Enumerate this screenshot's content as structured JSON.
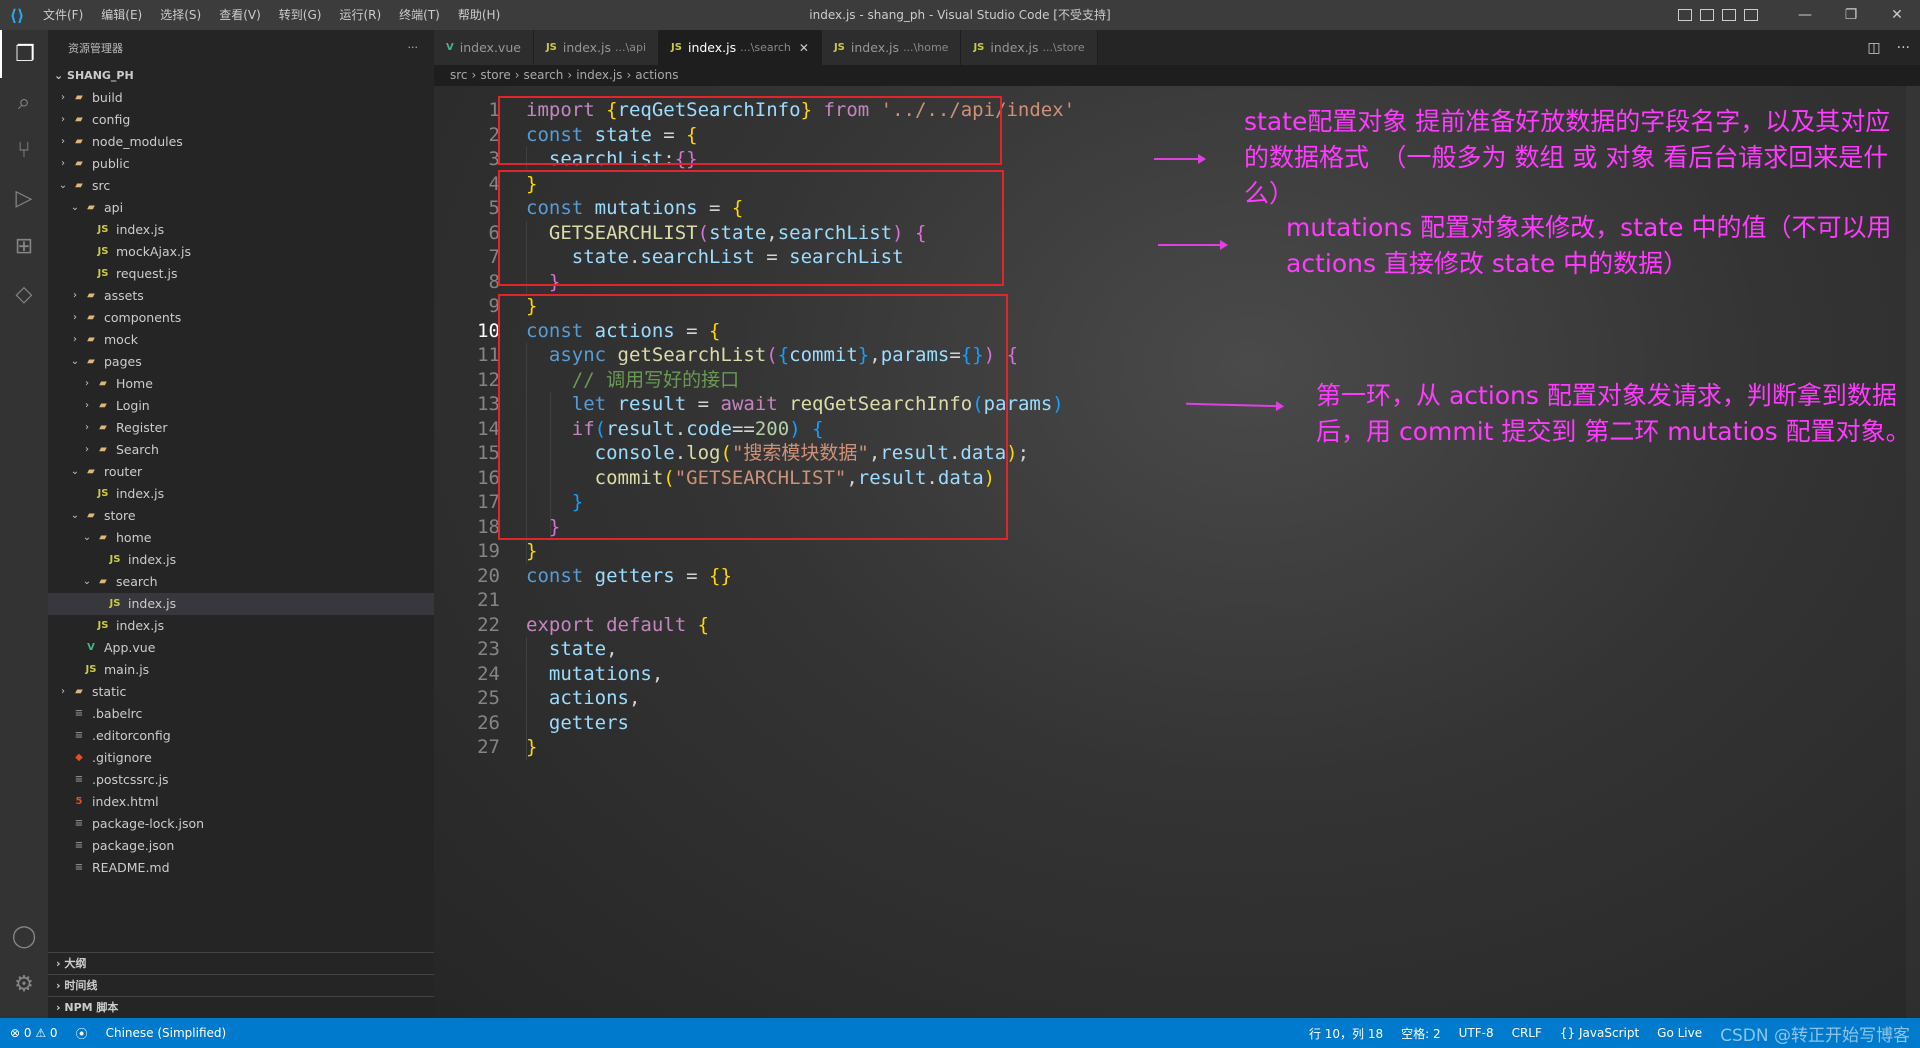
{
  "titlebar": {
    "menu": [
      "文件(F)",
      "编辑(E)",
      "选择(S)",
      "查看(V)",
      "转到(G)",
      "运行(R)",
      "终端(T)",
      "帮助(H)"
    ],
    "title": "index.js - shang_ph - Visual Studio Code [不受支持]"
  },
  "sidebar": {
    "header": "资源管理器",
    "more": "···",
    "root": "SHANG_PH",
    "tree": [
      {
        "label": "build",
        "depth": 1,
        "kind": "folder",
        "open": false
      },
      {
        "label": "config",
        "depth": 1,
        "kind": "folder",
        "open": false
      },
      {
        "label": "node_modules",
        "depth": 1,
        "kind": "folder",
        "open": false
      },
      {
        "label": "public",
        "depth": 1,
        "kind": "folder",
        "open": false
      },
      {
        "label": "src",
        "depth": 1,
        "kind": "folder",
        "open": true
      },
      {
        "label": "api",
        "depth": 2,
        "kind": "folder",
        "open": true
      },
      {
        "label": "index.js",
        "depth": 3,
        "kind": "js"
      },
      {
        "label": "mockAjax.js",
        "depth": 3,
        "kind": "js"
      },
      {
        "label": "request.js",
        "depth": 3,
        "kind": "js"
      },
      {
        "label": "assets",
        "depth": 2,
        "kind": "folder",
        "open": false
      },
      {
        "label": "components",
        "depth": 2,
        "kind": "folder",
        "open": false
      },
      {
        "label": "mock",
        "depth": 2,
        "kind": "folder",
        "open": false
      },
      {
        "label": "pages",
        "depth": 2,
        "kind": "folder",
        "open": true
      },
      {
        "label": "Home",
        "depth": 3,
        "kind": "folder",
        "open": false
      },
      {
        "label": "Login",
        "depth": 3,
        "kind": "folder",
        "open": false
      },
      {
        "label": "Register",
        "depth": 3,
        "kind": "folder",
        "open": false
      },
      {
        "label": "Search",
        "depth": 3,
        "kind": "folder",
        "open": false
      },
      {
        "label": "router",
        "depth": 2,
        "kind": "folder",
        "open": true
      },
      {
        "label": "index.js",
        "depth": 3,
        "kind": "js"
      },
      {
        "label": "store",
        "depth": 2,
        "kind": "folder",
        "open": true
      },
      {
        "label": "home",
        "depth": 3,
        "kind": "folder",
        "open": true
      },
      {
        "label": "index.js",
        "depth": 4,
        "kind": "js"
      },
      {
        "label": "search",
        "depth": 3,
        "kind": "folder",
        "open": true
      },
      {
        "label": "index.js",
        "depth": 4,
        "kind": "js",
        "selected": true
      },
      {
        "label": "index.js",
        "depth": 3,
        "kind": "js"
      },
      {
        "label": "App.vue",
        "depth": 2,
        "kind": "vue"
      },
      {
        "label": "main.js",
        "depth": 2,
        "kind": "js"
      },
      {
        "label": "static",
        "depth": 1,
        "kind": "folder",
        "open": false
      },
      {
        "label": ".babelrc",
        "depth": 1,
        "kind": "cfg"
      },
      {
        "label": ".editorconfig",
        "depth": 1,
        "kind": "cfg"
      },
      {
        "label": ".gitignore",
        "depth": 1,
        "kind": "git"
      },
      {
        "label": ".postcssrc.js",
        "depth": 1,
        "kind": "cfg"
      },
      {
        "label": "index.html",
        "depth": 1,
        "kind": "html"
      },
      {
        "label": "package-lock.json",
        "depth": 1,
        "kind": "cfg"
      },
      {
        "label": "package.json",
        "depth": 1,
        "kind": "cfg"
      },
      {
        "label": "README.md",
        "depth": 1,
        "kind": "cfg"
      }
    ],
    "sections": [
      "大纲",
      "时间线",
      "NPM 脚本"
    ]
  },
  "tabs": [
    {
      "icon": "V",
      "name": "index.vue",
      "desc": "",
      "active": false,
      "kind": "vue"
    },
    {
      "icon": "JS",
      "name": "index.js",
      "desc": "...\\api",
      "active": false,
      "kind": "js"
    },
    {
      "icon": "JS",
      "name": "index.js",
      "desc": "...\\search",
      "active": true,
      "kind": "js"
    },
    {
      "icon": "JS",
      "name": "index.js",
      "desc": "...\\home",
      "active": false,
      "kind": "js"
    },
    {
      "icon": "JS",
      "name": "index.js",
      "desc": "...\\store",
      "active": false,
      "kind": "js"
    }
  ],
  "breadcrumbs": [
    "src",
    "store",
    "search",
    "index.js",
    "actions"
  ],
  "code": [
    [
      [
        "kw2",
        "import "
      ],
      [
        "br1",
        "{"
      ],
      [
        "var",
        "reqGetSearchInfo"
      ],
      [
        "br1",
        "}"
      ],
      [
        "kw2",
        " from "
      ],
      [
        "str",
        "'../../api/index'"
      ]
    ],
    [
      [
        "kw",
        "const "
      ],
      [
        "var",
        "state"
      ],
      [
        "pl",
        " = "
      ],
      [
        "br1",
        "{"
      ]
    ],
    [
      [
        "pl",
        "  "
      ],
      [
        "var",
        "searchList"
      ],
      [
        "pl",
        ":"
      ],
      [
        "br2",
        "{}"
      ]
    ],
    [
      [
        "br1",
        "}"
      ]
    ],
    [
      [
        "kw",
        "const "
      ],
      [
        "var",
        "mutations"
      ],
      [
        "pl",
        " = "
      ],
      [
        "br1",
        "{"
      ]
    ],
    [
      [
        "pl",
        "  "
      ],
      [
        "fn",
        "GETSEARCHLIST"
      ],
      [
        "br2",
        "("
      ],
      [
        "var",
        "state"
      ],
      [
        "pl",
        ","
      ],
      [
        "var",
        "searchList"
      ],
      [
        "br2",
        ")"
      ],
      [
        "pl",
        " "
      ],
      [
        "br2",
        "{"
      ]
    ],
    [
      [
        "pl",
        "    "
      ],
      [
        "var",
        "state"
      ],
      [
        "pl",
        "."
      ],
      [
        "var",
        "searchList"
      ],
      [
        "pl",
        " = "
      ],
      [
        "var",
        "searchList"
      ]
    ],
    [
      [
        "pl",
        "  "
      ],
      [
        "br2",
        "}"
      ]
    ],
    [
      [
        "br1",
        "}"
      ]
    ],
    [
      [
        "kw",
        "const "
      ],
      [
        "var",
        "actions"
      ],
      [
        "pl",
        " = "
      ],
      [
        "br1",
        "{"
      ]
    ],
    [
      [
        "pl",
        "  "
      ],
      [
        "kw",
        "async "
      ],
      [
        "fn",
        "getSearchList"
      ],
      [
        "br2",
        "("
      ],
      [
        "br3",
        "{"
      ],
      [
        "var",
        "commit"
      ],
      [
        "br3",
        "}"
      ],
      [
        "pl",
        ","
      ],
      [
        "var",
        "params"
      ],
      [
        "pl",
        "="
      ],
      [
        "br3",
        "{}"
      ],
      [
        "br2",
        ")"
      ],
      [
        "pl",
        " "
      ],
      [
        "br2",
        "{"
      ]
    ],
    [
      [
        "pl",
        "    "
      ],
      [
        "cm",
        "// 调用写好的接口"
      ]
    ],
    [
      [
        "pl",
        "    "
      ],
      [
        "kw",
        "let "
      ],
      [
        "var",
        "result"
      ],
      [
        "pl",
        " = "
      ],
      [
        "kw2",
        "await "
      ],
      [
        "fn",
        "reqGetSearchInfo"
      ],
      [
        "br3",
        "("
      ],
      [
        "var",
        "params"
      ],
      [
        "br3",
        ")"
      ]
    ],
    [
      [
        "pl",
        "    "
      ],
      [
        "kw2",
        "if"
      ],
      [
        "br3",
        "("
      ],
      [
        "var",
        "result"
      ],
      [
        "pl",
        "."
      ],
      [
        "var",
        "code"
      ],
      [
        "pl",
        "=="
      ],
      [
        "num",
        "200"
      ],
      [
        "br3",
        ")"
      ],
      [
        "pl",
        " "
      ],
      [
        "br3",
        "{"
      ]
    ],
    [
      [
        "pl",
        "      "
      ],
      [
        "var",
        "console"
      ],
      [
        "pl",
        "."
      ],
      [
        "fn",
        "log"
      ],
      [
        "br1",
        "("
      ],
      [
        "str",
        "\"搜索模块数据\""
      ],
      [
        "pl",
        ","
      ],
      [
        "var",
        "result"
      ],
      [
        "pl",
        "."
      ],
      [
        "var",
        "data"
      ],
      [
        "br1",
        ")"
      ],
      [
        "pl",
        ";"
      ]
    ],
    [
      [
        "pl",
        "      "
      ],
      [
        "fn",
        "commit"
      ],
      [
        "br1",
        "("
      ],
      [
        "str",
        "\"GETSEARCHLIST\""
      ],
      [
        "pl",
        ","
      ],
      [
        "var",
        "result"
      ],
      [
        "pl",
        "."
      ],
      [
        "var",
        "data"
      ],
      [
        "br1",
        ")"
      ]
    ],
    [
      [
        "pl",
        "    "
      ],
      [
        "br3",
        "}"
      ]
    ],
    [
      [
        "pl",
        "  "
      ],
      [
        "br2",
        "}"
      ]
    ],
    [
      [
        "br1",
        "}"
      ]
    ],
    [
      [
        "kw",
        "const "
      ],
      [
        "var",
        "getters"
      ],
      [
        "pl",
        " = "
      ],
      [
        "br1",
        "{}"
      ]
    ],
    [],
    [
      [
        "kw2",
        "export "
      ],
      [
        "kw2",
        "default "
      ],
      [
        "br1",
        "{"
      ]
    ],
    [
      [
        "pl",
        "  "
      ],
      [
        "var",
        "state"
      ],
      [
        "pl",
        ","
      ]
    ],
    [
      [
        "pl",
        "  "
      ],
      [
        "var",
        "mutations"
      ],
      [
        "pl",
        ","
      ]
    ],
    [
      [
        "pl",
        "  "
      ],
      [
        "var",
        "actions"
      ],
      [
        "pl",
        ","
      ]
    ],
    [
      [
        "pl",
        "  "
      ],
      [
        "var",
        "getters"
      ]
    ],
    [
      [
        "br1",
        "}"
      ]
    ]
  ],
  "current_line": 10,
  "annotations": {
    "state_note": "state配置对象 提前准备好放数据的字段名字，以及其对应的数据格式　（一般多为 数组 或 对象 看后台请求回来是什么）",
    "mutations_note": "mutations 配置对象来修改，state 中的值（不可以用actions 直接修改 state 中的数据）",
    "actions_note": "第一环，从 actions 配置对象发请求，判断拿到数据后，用 commit 提交到 第二环 mutatios 配置对象。"
  },
  "statusbar": {
    "errors": "0",
    "warnings": "0",
    "lang_pack": "Chinese (Simplified)",
    "position": "行 10，列 18",
    "spaces": "空格: 2",
    "encoding": "UTF-8",
    "eol": "CRLF",
    "language": "JavaScript",
    "golive": "Go Live",
    "watermark": "CSDN @转正开始写博客"
  }
}
